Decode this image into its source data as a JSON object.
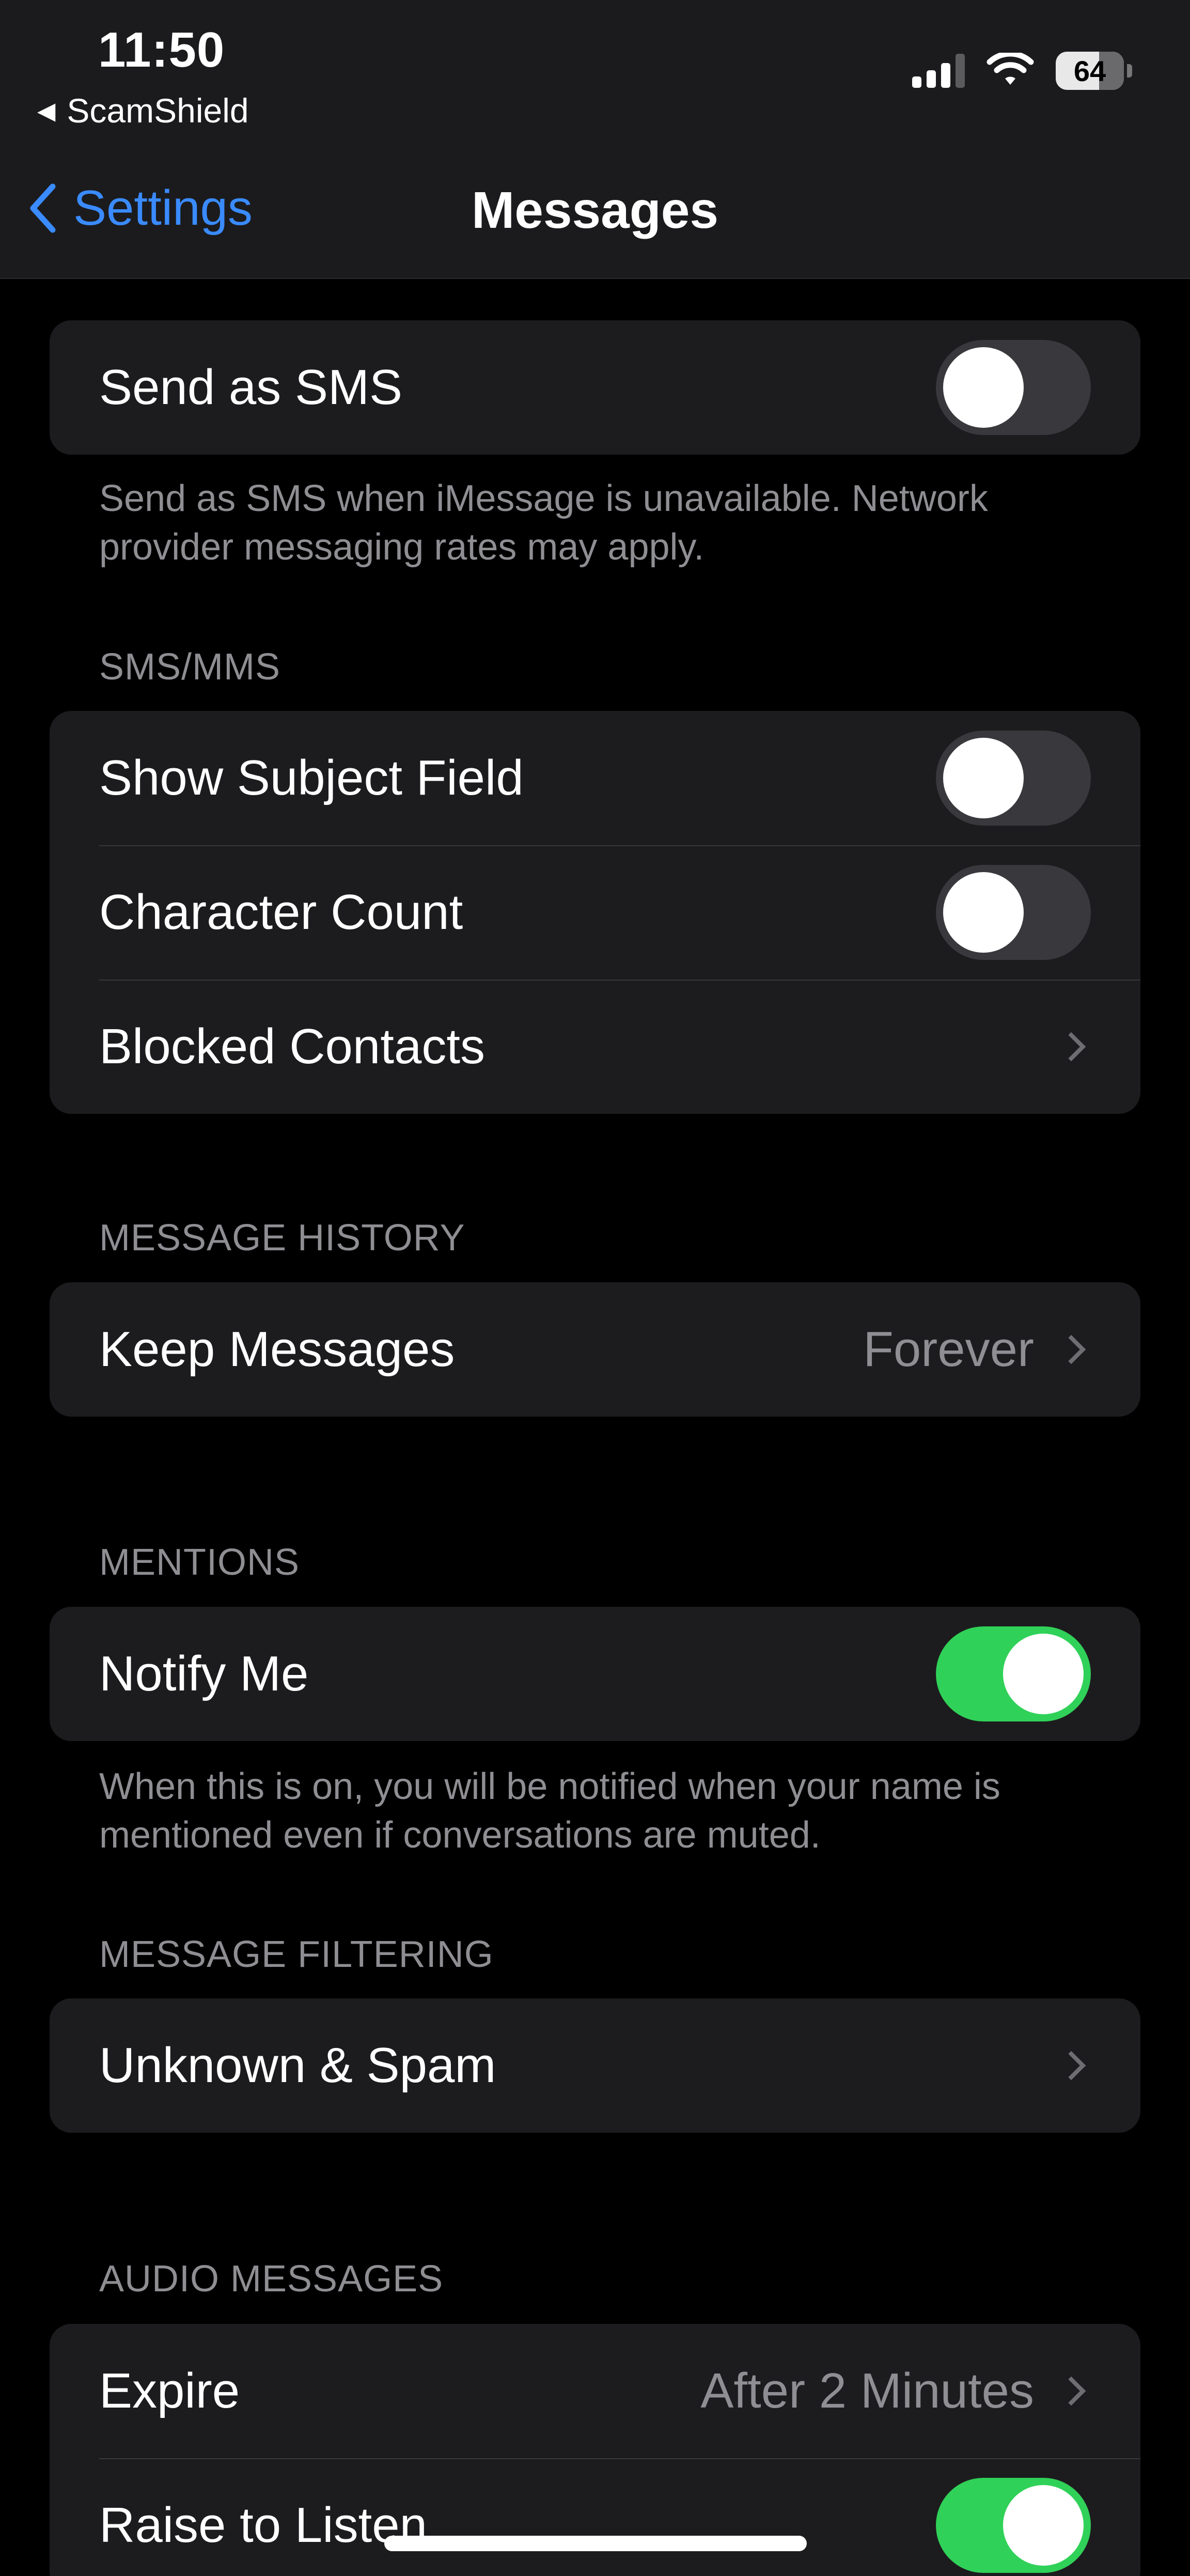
{
  "status_bar": {
    "time": "11:50",
    "back_app": "ScamShield",
    "battery": "64"
  },
  "nav": {
    "back_label": "Settings",
    "title": "Messages"
  },
  "send_as_sms": {
    "label": "Send as SMS",
    "on": false,
    "footer": "Send as SMS when iMessage is unavailable. Network provider messaging rates may apply."
  },
  "sms_mms": {
    "header": "SMS/MMS",
    "show_subject_label": "Show Subject Field",
    "show_subject_on": false,
    "character_count_label": "Character Count",
    "character_count_on": false,
    "blocked_contacts_label": "Blocked Contacts"
  },
  "message_history": {
    "header": "MESSAGE HISTORY",
    "keep_messages_label": "Keep Messages",
    "keep_messages_value": "Forever"
  },
  "mentions": {
    "header": "MENTIONS",
    "notify_me_label": "Notify Me",
    "notify_me_on": true,
    "footer": "When this is on, you will be notified when your name is mentioned even if conversations are muted."
  },
  "message_filtering": {
    "header": "MESSAGE FILTERING",
    "unknown_spam_label": "Unknown & Spam"
  },
  "audio_messages": {
    "header": "AUDIO MESSAGES",
    "expire_label": "Expire",
    "expire_value": "After 2 Minutes",
    "raise_to_listen_label": "Raise to Listen",
    "raise_to_listen_on": true
  },
  "colors": {
    "accent": "#3a8bff",
    "toggle_on": "#30d158",
    "toggle_off": "#39393d",
    "group_bg": "#1c1c1e",
    "secondary_text": "#8e8e93"
  }
}
